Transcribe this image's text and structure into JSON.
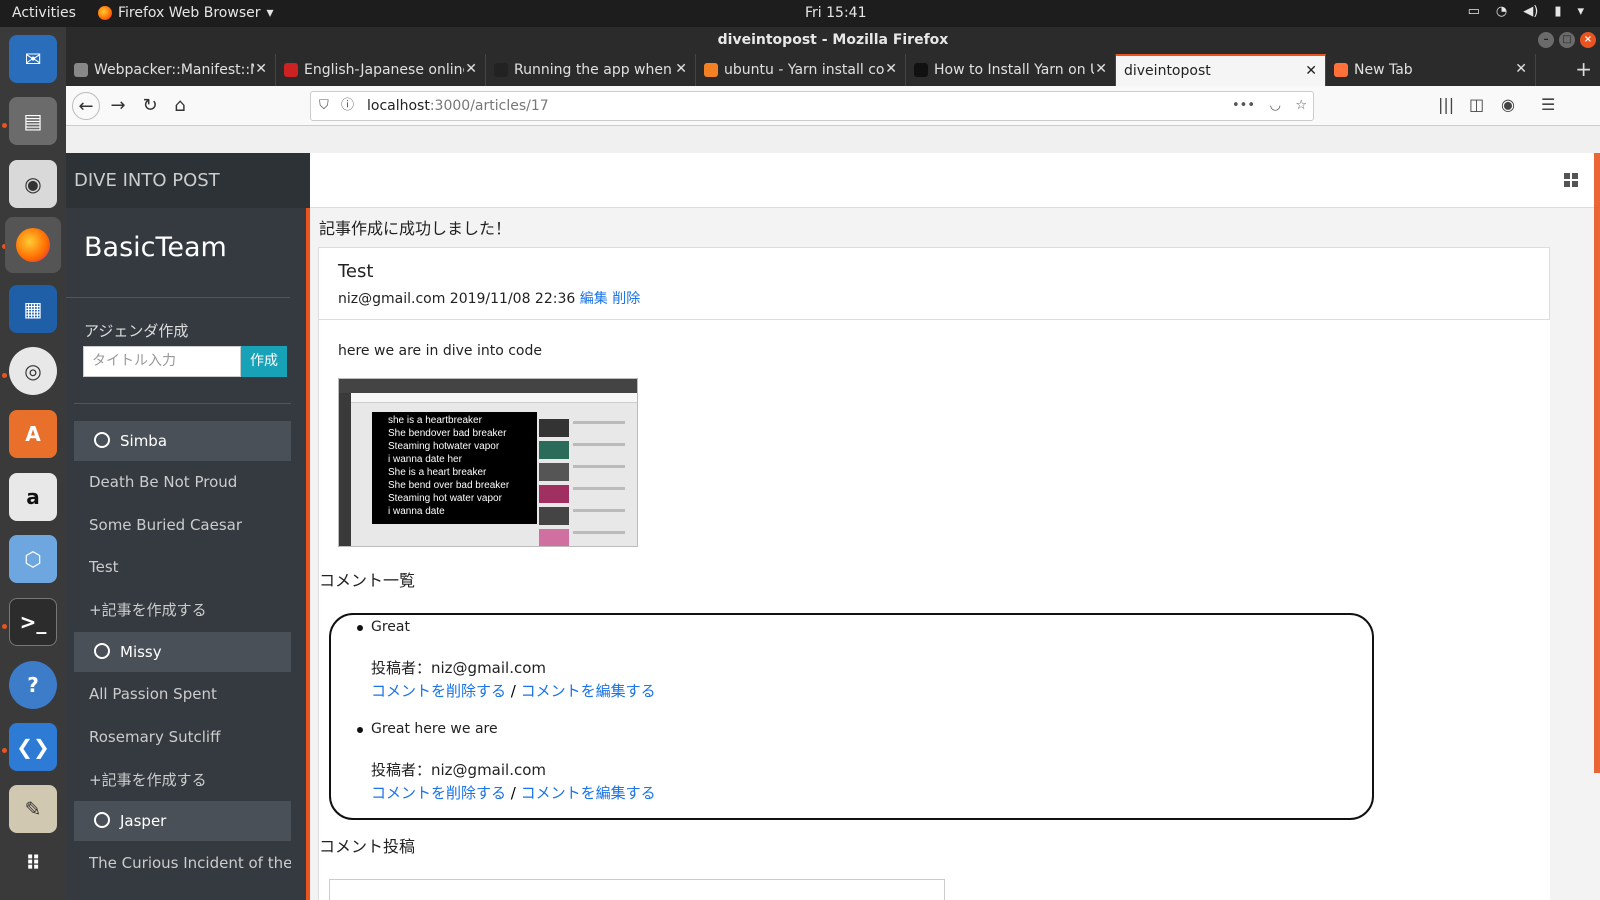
{
  "topbar": {
    "activities": "Activities",
    "app_name": "Firefox Web Browser",
    "clock": "Fri 15:41"
  },
  "window": {
    "title": "diveintopost - Mozilla Firefox"
  },
  "tabs": [
    {
      "label": "Webpacker::Manifest::Mis",
      "color": "#888888"
    },
    {
      "label": "English-Japanese online",
      "color": "#cc2222"
    },
    {
      "label": "Running the app when y",
      "color": "#222222"
    },
    {
      "label": "ubuntu - Yarn install co",
      "color": "#f48024"
    },
    {
      "label": "How to Install Yarn on U",
      "color": "#111111"
    },
    {
      "label": "diveintopost",
      "color": "#f5f5f5"
    },
    {
      "label": "New Tab",
      "color": "#ff7139"
    }
  ],
  "url": {
    "host": "localhost",
    "path": ":3000/articles/17"
  },
  "sidebar": {
    "brand": "DIVE INTO POST",
    "team": "BasicTeam",
    "agenda_label": "アジェンダ作成",
    "agenda_placeholder": "タイトル入力",
    "agenda_button": "作成",
    "groups": [
      {
        "name": "Simba",
        "articles": [
          "Death Be Not Proud",
          "Some Buried Caesar",
          "Test"
        ],
        "add": "+記事を作成する"
      },
      {
        "name": "Missy",
        "articles": [
          "All Passion Spent",
          "Rosemary Sutcliff"
        ],
        "add": "+記事を作成する"
      },
      {
        "name": "Jasper",
        "articles": [
          "The Curious Incident of the Dog"
        ],
        "add": ""
      }
    ]
  },
  "main": {
    "flash": "記事作成に成功しました！",
    "article": {
      "title": "Test",
      "meta": "niz@gmail.com 2019/11/08 22:36",
      "edit": "編集",
      "delete": "削除",
      "body": "here we are in dive into code",
      "image_lyrics": [
        "she is a heartbreaker",
        "She bendover bad breaker",
        "Steaming hotwater vapor",
        "i wanna date her",
        "She is a heart breaker",
        "She bend over bad breaker",
        "Steaming hot water vapor",
        "i wanna date"
      ]
    },
    "comments_label": "コメント一覧",
    "comments": [
      {
        "text": "Great",
        "poster": "投稿者：niz@gmail.com",
        "delete": "コメントを削除する",
        "sep": " / ",
        "edit": "コメントを編集する"
      },
      {
        "text": "Great here we are",
        "poster": "投稿者：niz@gmail.com",
        "delete": "コメントを削除する",
        "sep": " / ",
        "edit": "コメントを編集する"
      }
    ],
    "post_label": "コメント投稿"
  }
}
